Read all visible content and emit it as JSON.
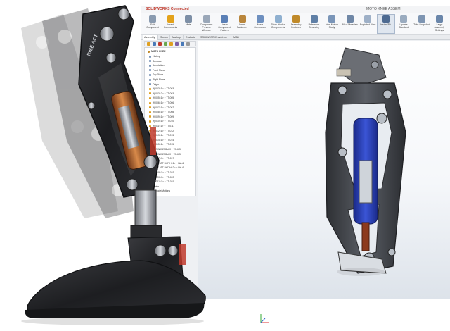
{
  "app": {
    "brand": "SOLIDWORKS Connected",
    "document_title": "MOTO KNEE ASSEM"
  },
  "ribbon": {
    "buttons": [
      {
        "label": "Edit Component",
        "color": "#8a9bb0"
      },
      {
        "label": "Insert Components",
        "color": "#e3a21a"
      },
      {
        "label": "Mate",
        "color": "#7d8fa6"
      },
      {
        "label": "Component Preview Window",
        "color": "#9aa7b8"
      },
      {
        "label": "Linear Component Pattern",
        "color": "#5a7fb6"
      },
      {
        "label": "Smart Fasteners",
        "color": "#b9863c"
      },
      {
        "label": "Move Component",
        "color": "#6d8fbf"
      },
      {
        "label": "Show Hidden Components",
        "color": "#8fb0d0"
      },
      {
        "label": "Assembly Features",
        "color": "#c08a2a"
      },
      {
        "label": "Reference Geometry",
        "color": "#5f7fa6"
      },
      {
        "label": "New Motion Study",
        "color": "#7a95b8"
      },
      {
        "label": "Bill of Materials",
        "color": "#6f87a6"
      },
      {
        "label": "Exploded View",
        "color": "#9eb0c7"
      },
      {
        "label": "Instant3D",
        "color": "#4d6a91"
      },
      {
        "label": "Update Standard",
        "color": "#9aabbf"
      },
      {
        "label": "Take Snapshot",
        "color": "#7e95b2"
      },
      {
        "label": "Large Assembly Settings",
        "color": "#6a86aa"
      }
    ]
  },
  "tabs": [
    "Assembly",
    "Sketch",
    "Markup",
    "Evaluate",
    "SOLIDWORKS Add-Ins",
    "MBD"
  ],
  "feature_tree": {
    "root": "MOTO KNEE",
    "items": [
      "History",
      "Sensors",
      "Annotations",
      "Front Plane",
      "Top Plane",
      "Right Plane",
      "Origin",
      "(f) 003<1> ~ TT-003",
      "(f) 003<2> ~ TT-003",
      "(f) 005<1> ~ TT-005",
      "(f) 006<1> ~ TT-006",
      "(f) 007<1> ~ TT-007",
      "(f) 008<1> ~ TT-008",
      "(f) 009<1> ~ TT-009",
      "(f) 010<1> ~ TT-010",
      "(f) 011<1> ~ TT-011",
      "(f) 012<1> ~ TT-012",
      "(f) 013<1> ~ TT-013",
      "(f) 014<1> ~ TT-014",
      "(f) 015<1> ~ TT-015",
      "(-) DIN912M6x20 ~ TA-6.3",
      "(-) DIN912M6x20 ~ TA-6.3",
      "(-) 017<1> ~ TT-017",
      "(-) EX ATT MOTH<1> ~ Bkt-6",
      "(-) EX ATT MOTH<2> ~ Bkt-6",
      "(-) 019<1> ~ TT-019",
      "(-) 020<1> ~ TT-020",
      "(-) 021<1> ~ TT-021",
      "Mates",
      "Explode/Motions"
    ]
  },
  "toolbar_icon_colors": [
    "#e0a020",
    "#4a7ab8",
    "#c0392b",
    "#6aa84f",
    "#e0a020",
    "#7d5fa6",
    "#4a7ab8",
    "#999999"
  ],
  "branding": {
    "leg_logo": "RISE ACT"
  }
}
